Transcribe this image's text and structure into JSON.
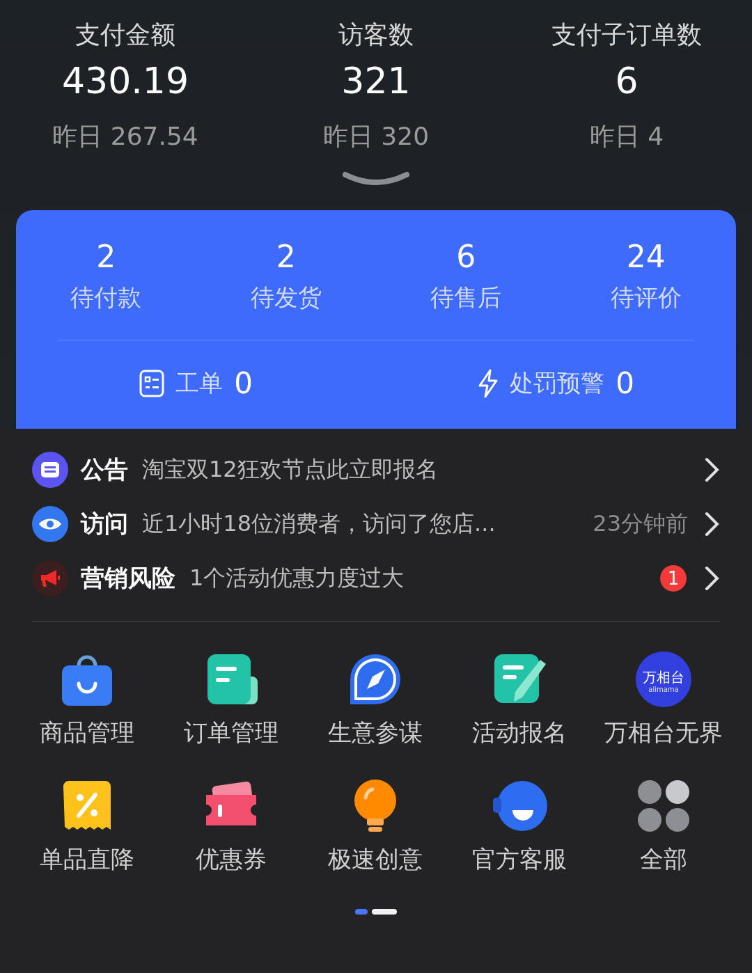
{
  "stats": [
    {
      "label": "支付金额",
      "value": "430.19",
      "yesterday": "昨日 267.54"
    },
    {
      "label": "访客数",
      "value": "321",
      "yesterday": "昨日 320"
    },
    {
      "label": "支付子订单数",
      "value": "6",
      "yesterday": "昨日 4"
    }
  ],
  "orders": [
    {
      "count": "2",
      "label": "待付款"
    },
    {
      "count": "2",
      "label": "待发货"
    },
    {
      "count": "6",
      "label": "待售后"
    },
    {
      "count": "24",
      "label": "待评价"
    }
  ],
  "tickets": [
    {
      "kind": "ticket",
      "label": "工单",
      "count": "0"
    },
    {
      "kind": "penalty",
      "label": "处罚预警",
      "count": "0"
    }
  ],
  "notices": [
    {
      "kind": "announcement",
      "title": "公告",
      "text": "淘宝双12狂欢节点此立即报名"
    },
    {
      "kind": "visit",
      "title": "访问",
      "text": "近1小时18位消费者，访问了您店...",
      "time": "23分钟前"
    },
    {
      "kind": "risk",
      "title": "营销风险",
      "text": "1个活动优惠力度过大",
      "badge": "1"
    }
  ],
  "tools": [
    {
      "kind": "bag",
      "label": "商品管理"
    },
    {
      "kind": "order",
      "label": "订单管理"
    },
    {
      "kind": "compass",
      "label": "生意参谋"
    },
    {
      "kind": "signup",
      "label": "活动报名"
    },
    {
      "kind": "logo",
      "label": "万相台无界",
      "logo_text": "万相台",
      "logo_subtext": "alimama"
    },
    {
      "kind": "discount",
      "label": "单品直降"
    },
    {
      "kind": "coupon",
      "label": "优惠券"
    },
    {
      "kind": "bulb",
      "label": "极速创意"
    },
    {
      "kind": "service",
      "label": "官方客服"
    },
    {
      "kind": "grid",
      "label": "全部"
    }
  ],
  "pages": [
    {
      "selected": true
    },
    {
      "selected": false
    }
  ]
}
